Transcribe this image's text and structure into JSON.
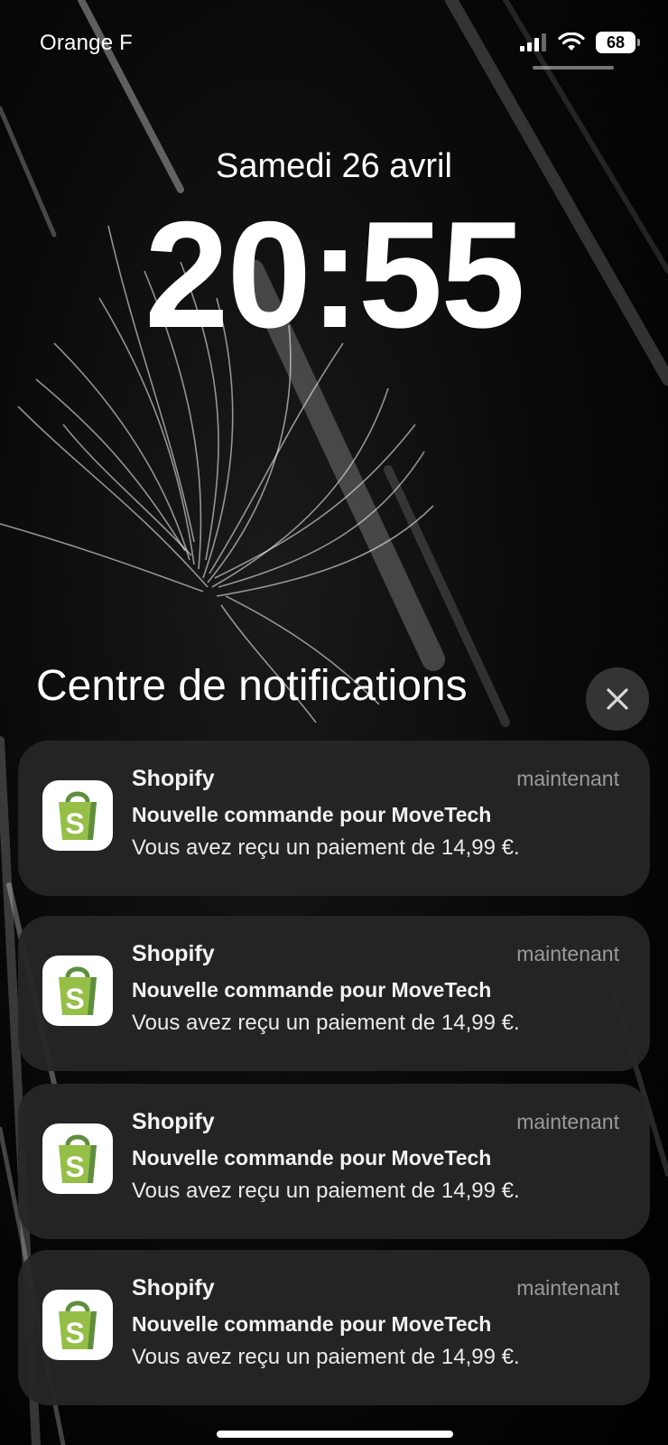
{
  "status_bar": {
    "carrier": "Orange F",
    "battery_level": "68",
    "icons": [
      "signal-icon",
      "wifi-icon",
      "battery-icon"
    ]
  },
  "lock_screen": {
    "date": "Samedi 26 avril",
    "time": "20:55"
  },
  "notification_center": {
    "title": "Centre de notifications",
    "close_icon": "close-icon",
    "notifications": [
      {
        "app": "Shopify",
        "time": "maintenant",
        "title": "Nouvelle commande pour MoveTech",
        "body": "Vous avez reçu un paiement de 14,99 €.",
        "icon": "shopify-icon"
      },
      {
        "app": "Shopify",
        "time": "maintenant",
        "title": "Nouvelle commande pour MoveTech",
        "body": "Vous avez reçu un paiement de 14,99 €.",
        "icon": "shopify-icon"
      },
      {
        "app": "Shopify",
        "time": "maintenant",
        "title": "Nouvelle commande pour MoveTech",
        "body": "Vous avez reçu un paiement de 14,99 €.",
        "icon": "shopify-icon"
      },
      {
        "app": "Shopify",
        "time": "maintenant",
        "title": "Nouvelle commande pour MoveTech",
        "body": "Vous avez reçu un paiement de 14,99 €.",
        "icon": "shopify-icon"
      }
    ]
  },
  "colors": {
    "shopify_green": "#95bf47",
    "shopify_dark_green": "#5e8e3e",
    "card_background": "#262626",
    "secondary_text": "#9a9a9a"
  }
}
